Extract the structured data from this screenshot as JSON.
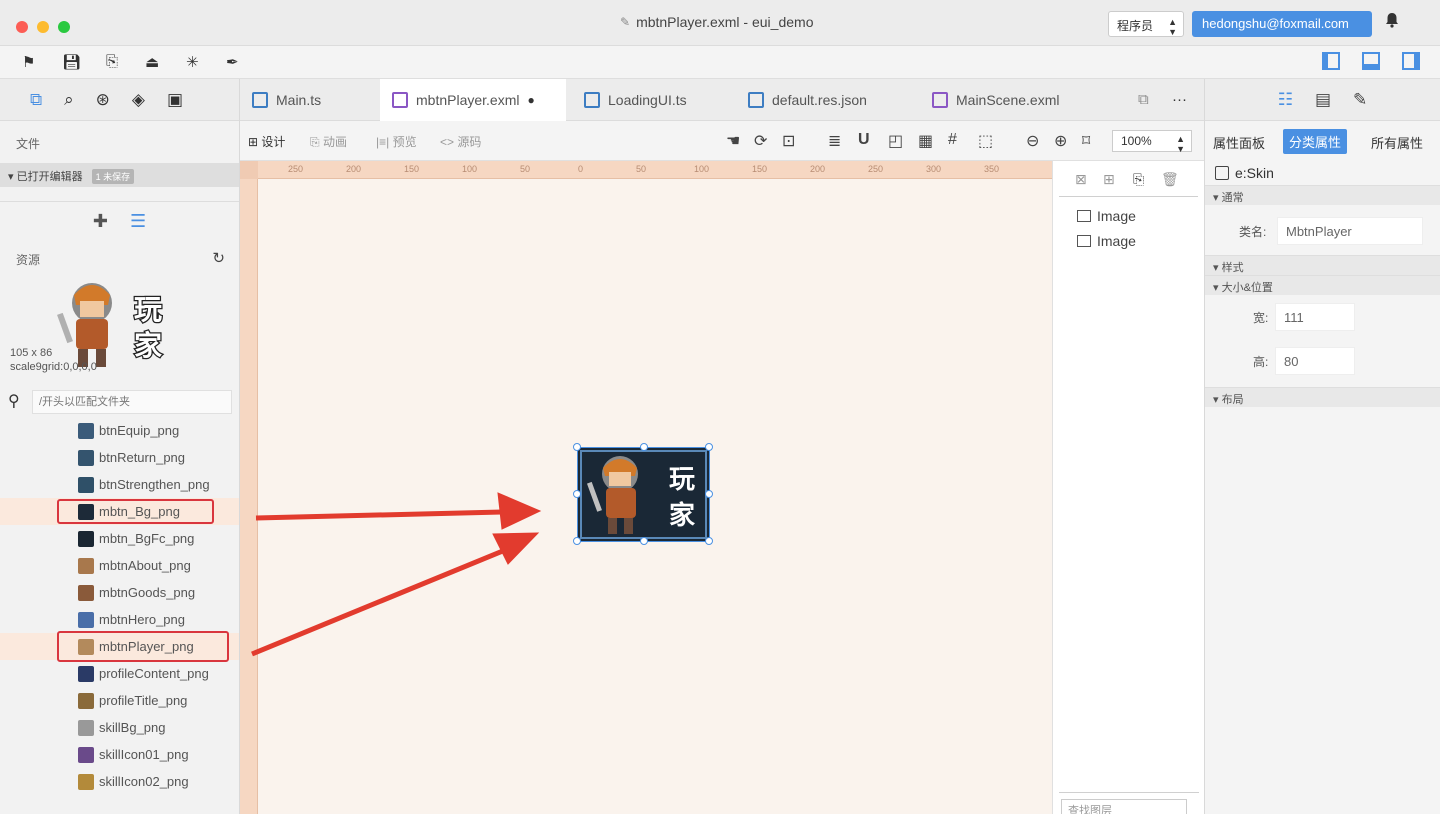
{
  "window": {
    "title": "mbtnPlayer.exml - eui_demo",
    "role_select": "程序员",
    "user_email": "hedongshu@foxmail.com"
  },
  "left": {
    "files_label": "文件",
    "open_editors_label": "已打开编辑器",
    "open_editors_badge": "1 未保存",
    "resources_label": "资源",
    "preview_size": "105 x 86",
    "preview_scale9": "scale9grid:0,0,0,0",
    "search_placeholder": "/开头以匹配文件夹",
    "resources": [
      {
        "name": "btnEquip_png",
        "color": "#3b5b7a"
      },
      {
        "name": "btnReturn_png",
        "color": "#34546e"
      },
      {
        "name": "btnStrengthen_png",
        "color": "#2f5068"
      },
      {
        "name": "mbtn_Bg_png",
        "color": "#1d2a38",
        "highlighted": true
      },
      {
        "name": "mbtn_BgFc_png",
        "color": "#1a2632"
      },
      {
        "name": "mbtnAbout_png",
        "color": "#a8784c"
      },
      {
        "name": "mbtnGoods_png",
        "color": "#8a5a3a"
      },
      {
        "name": "mbtnHero_png",
        "color": "#4a6ea8"
      },
      {
        "name": "mbtnPlayer_png",
        "color": "#b38a5c",
        "highlighted": true
      },
      {
        "name": "profileContent_png",
        "color": "#2a3a66"
      },
      {
        "name": "profileTitle_png",
        "color": "#8a6a3a"
      },
      {
        "name": "skillBg_png",
        "color": "#999999"
      },
      {
        "name": "skillIcon01_png",
        "color": "#6a4a8a"
      },
      {
        "name": "skillIcon02_png",
        "color": "#b38a3a"
      }
    ]
  },
  "editor": {
    "tabs": [
      {
        "label": "Main.ts"
      },
      {
        "label": "mbtnPlayer.exml",
        "dirty": "●"
      },
      {
        "label": "LoadingUI.ts"
      },
      {
        "label": "default.res.json"
      },
      {
        "label": "MainScene.exml"
      }
    ],
    "more": "···",
    "modes": {
      "design": "设计",
      "animation": "动画",
      "preview": "预览",
      "source": "源码"
    },
    "zoom": "100%",
    "ruler_ticks": [
      "250",
      "200",
      "150",
      "100",
      "50",
      "0",
      "50",
      "100",
      "150",
      "200",
      "250",
      "300",
      "350"
    ],
    "sprite_text": "玩家"
  },
  "layers": {
    "items": [
      "Image",
      "Image"
    ],
    "bottom_select": "查找图层"
  },
  "right": {
    "tabs": {
      "panel": "属性面板",
      "category": "分类属性",
      "all": "所有属性"
    },
    "skin": "e:Skin",
    "groups": {
      "common": "通常",
      "style": "样式",
      "size_pos": "大小&位置",
      "layout": "布局"
    },
    "class_label": "类名:",
    "class_value": "MbtnPlayer",
    "width_label": "宽:",
    "width_value": "111",
    "height_label": "高:",
    "height_value": "80"
  },
  "colors": {
    "accent": "#4a90e2",
    "highlight_box": "#d9363e",
    "arrow": "#e23b2e",
    "canvas_bg": "#faf3ed",
    "ruler": "#f6d7c2"
  }
}
